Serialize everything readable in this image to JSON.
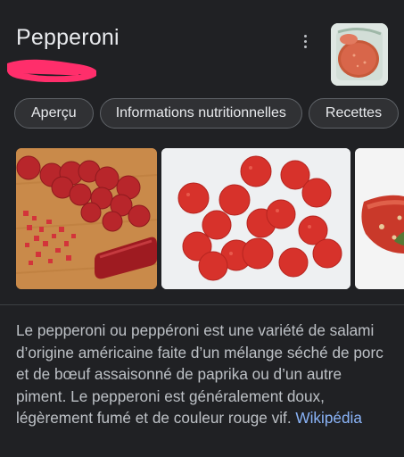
{
  "header": {
    "title": "Pepperoni"
  },
  "tabs": [
    {
      "label": "Aperçu"
    },
    {
      "label": "Informations nutritionnelles"
    },
    {
      "label": "Recettes"
    }
  ],
  "description": {
    "text": "Le pepperoni ou peppéroni est une variété de salami d’origine américaine faite d’un mélange séché de porc et de bœuf assaisonné de paprika ou d’un autre piment. Le pepperoni est généralement doux, légèrement fumé et de couleur rouge vif.",
    "source_link": "Wikipédia"
  },
  "colors": {
    "background": "#202124",
    "text_primary": "#e8eaed",
    "text_secondary": "#bdc1c6",
    "link": "#8ab4f8",
    "chip_border": "#5f6368",
    "redaction": "#ff2e6b"
  },
  "icons": {
    "more": "more-vertical-icon"
  }
}
